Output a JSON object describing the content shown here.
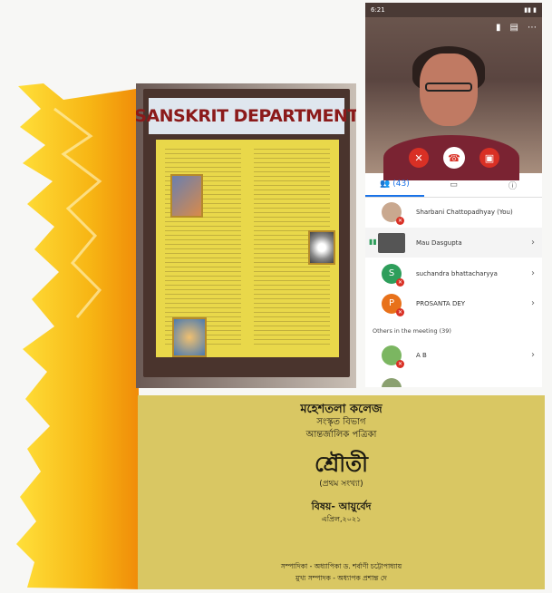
{
  "board": {
    "banner": "SANSKRIT DEPARTMENT"
  },
  "phone": {
    "status_time": "6:21",
    "tabs": {
      "people_count": "(43)"
    },
    "participants": [
      {
        "name": "Sharbani Chattopadhyay (You)",
        "initial": "",
        "color": "#b8b8b8"
      },
      {
        "name": "Mau Dasgupta",
        "initial": "",
        "color": "#555555"
      },
      {
        "name": "suchandra bhattacharyya",
        "initial": "S",
        "color": "#2e9e5b"
      },
      {
        "name": "PROSANTA DEY",
        "initial": "P",
        "color": "#e8711a"
      }
    ],
    "others_heading": "Others in the meeting (39)",
    "other_participants": [
      {
        "name": "A B",
        "initial": "",
        "color": "#7bb661"
      }
    ]
  },
  "cover": {
    "college": "মহেশতলা কলেজ",
    "department": "সংস্কৃত বিভাগ",
    "magazine": "আন্তর্জালিক পত্রিকা",
    "title": "শ্রৌতী",
    "issue": "(প্রথম সংখ্যা)",
    "subject": "বিষয়- আয়ুর্বেদ",
    "date": "এপ্রিল,২০২১",
    "editor": "সম্পাদিকা - অধ্যাপিকা ড. শর্বাণী চট্টোপাধ্যায়",
    "chief_editor": "মুখ্য সম্পাদক - অধ্যাপক প্রশান্ত দে"
  },
  "colors": {
    "brush_yellow": "#ffd21a",
    "brush_orange": "#f59a0c",
    "end_call": "#d93025",
    "accent_blue": "#1a73e8"
  }
}
